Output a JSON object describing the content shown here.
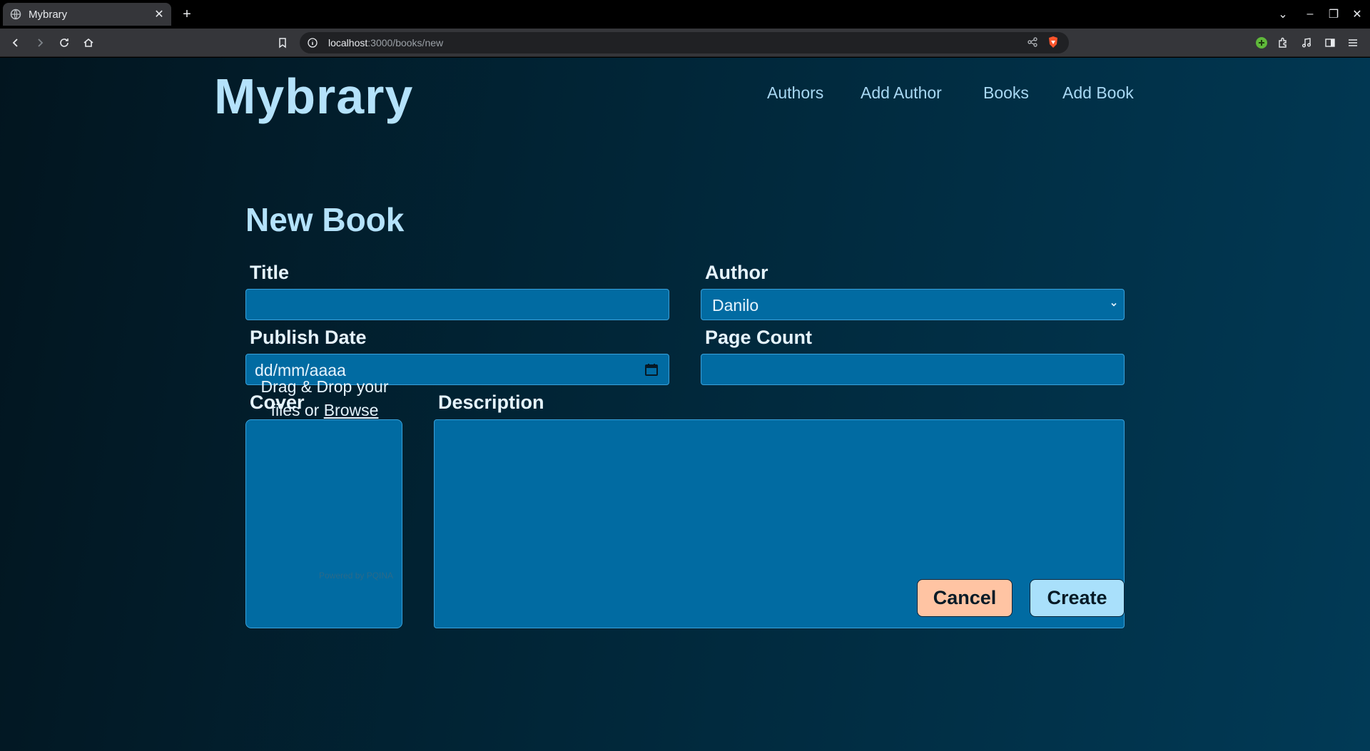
{
  "browser": {
    "tab_title": "Mybrary",
    "url_host": "localhost",
    "url_path": ":3000/books/new"
  },
  "site": {
    "brand": "Mybrary",
    "nav": [
      "Authors",
      "Add Author",
      "Books",
      "Add Book"
    ]
  },
  "form": {
    "heading": "New Book",
    "title_label": "Title",
    "title_value": "",
    "author_label": "Author",
    "author_selected": "Danilo",
    "publish_date_label": "Publish Date",
    "publish_date_placeholder": "dd/mm/aaaa",
    "page_count_label": "Page Count",
    "page_count_value": "",
    "cover_label": "Cover",
    "cover_drop_text": "Drag & Drop your files or",
    "cover_browse": "Browse",
    "powered_by": "Powered by PQINA",
    "description_label": "Description",
    "description_value": "",
    "cancel_label": "Cancel",
    "create_label": "Create"
  },
  "colors": {
    "field_bg": "#016ba2",
    "cancel_bg": "#ffc4a3",
    "create_bg": "#a9e0fb",
    "brand": "#b4e2fb"
  }
}
